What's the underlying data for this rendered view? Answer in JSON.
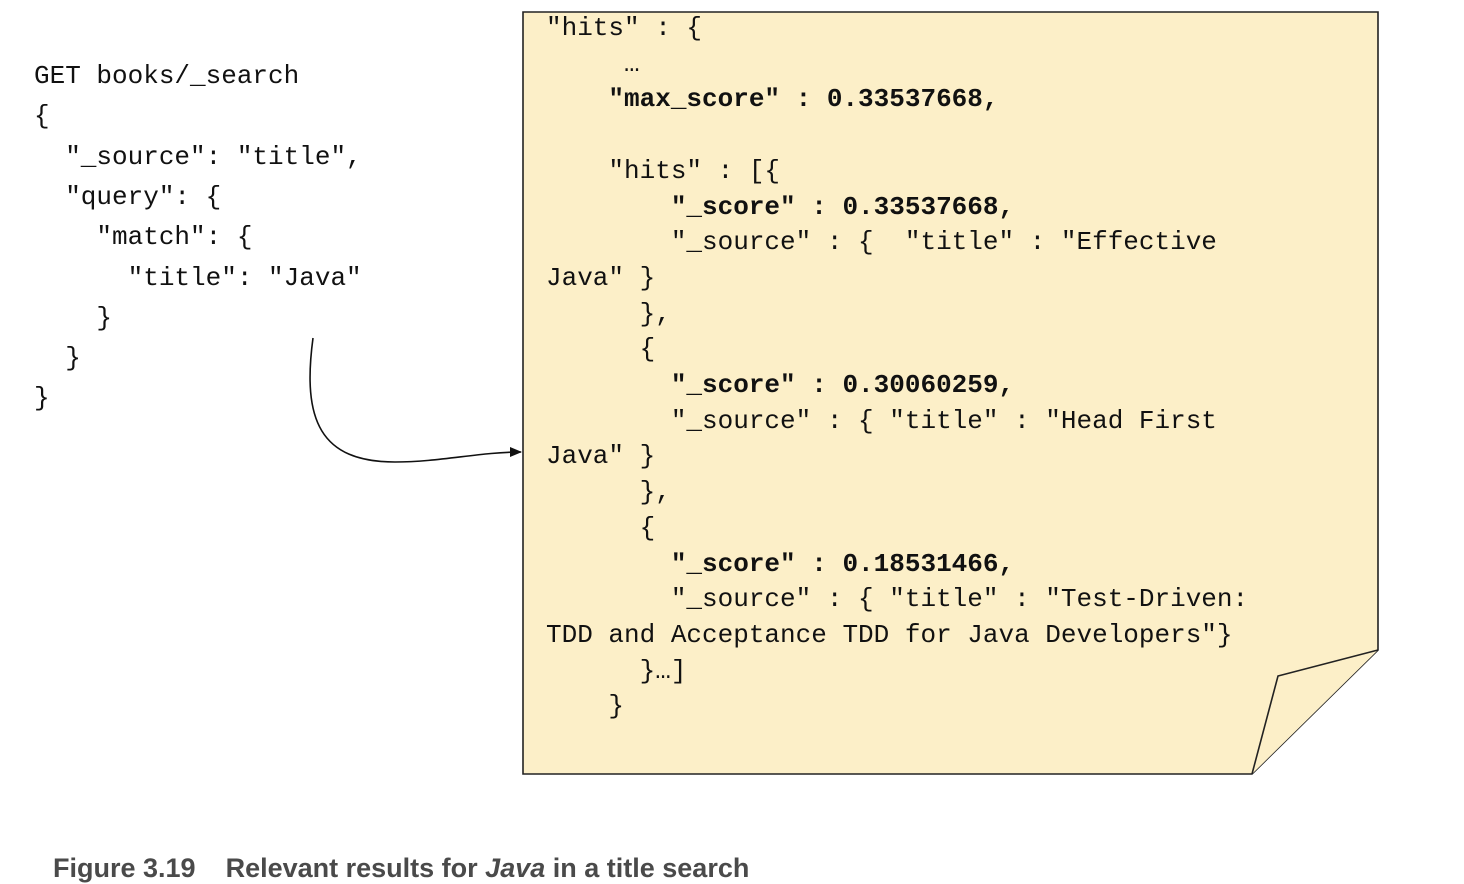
{
  "request": {
    "lines": [
      "GET books/_search",
      "{",
      "  \"_source\": \"title\",",
      "  \"query\": {",
      "    \"match\": {",
      "      \"title\": \"Java\"",
      "    }",
      "  }",
      "}"
    ]
  },
  "response": {
    "lines": [
      {
        "text": "\"hits\" : {",
        "bold": false
      },
      {
        "text": "     …",
        "bold": false
      },
      {
        "text": "    \"max_score\" : 0.33537668,",
        "bold": true
      },
      {
        "text": "",
        "bold": false
      },
      {
        "text": "    \"hits\" : [{",
        "bold": false
      },
      {
        "text": "        \"_score\" : 0.33537668,",
        "bold": true
      },
      {
        "text": "        \"_source\" : {  \"title\" : \"Effective",
        "bold": false
      },
      {
        "text": "Java\" }",
        "bold": false
      },
      {
        "text": "      },",
        "bold": false
      },
      {
        "text": "      {",
        "bold": false
      },
      {
        "text": "        \"_score\" : 0.30060259,",
        "bold": true
      },
      {
        "text": "        \"_source\" : { \"title\" : \"Head First",
        "bold": false
      },
      {
        "text": "Java\" }",
        "bold": false
      },
      {
        "text": "      },",
        "bold": false
      },
      {
        "text": "      {",
        "bold": false
      },
      {
        "text": "        \"_score\" : 0.18531466,",
        "bold": true
      },
      {
        "text": "        \"_source\" : { \"title\" : \"Test-Driven:",
        "bold": false
      },
      {
        "text": "TDD and Acceptance TDD for Java Developers\"}",
        "bold": false
      },
      {
        "text": "      }…]",
        "bold": false
      },
      {
        "text": "    }",
        "bold": false
      }
    ]
  },
  "caption": {
    "label": "Figure 3.19",
    "text_before": "Relevant results for ",
    "text_italic": "Java",
    "text_after": " in a title search"
  },
  "colors": {
    "note_fill": "#fcefc8",
    "note_stroke": "#222222",
    "caption": "#4a4a4a"
  }
}
